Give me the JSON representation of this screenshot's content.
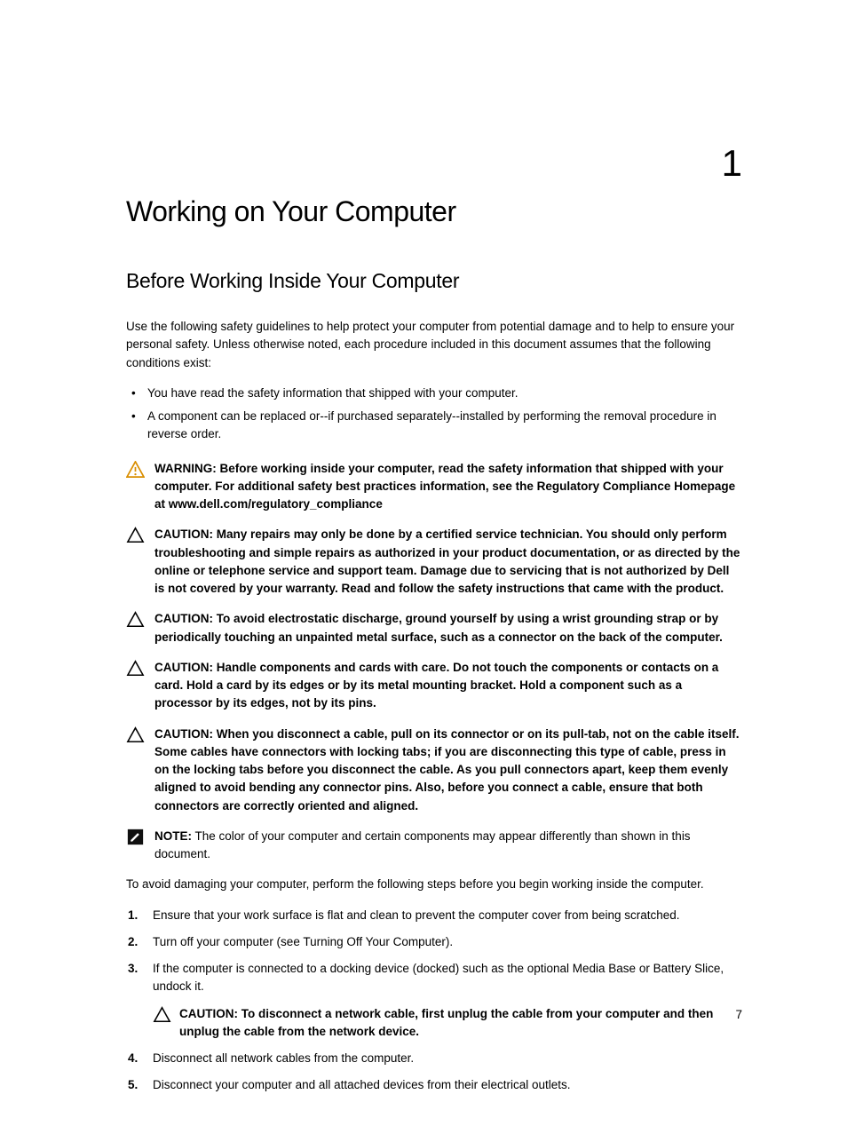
{
  "chapterNumber": "1",
  "title": "Working on Your Computer",
  "subheading": "Before Working Inside Your Computer",
  "intro": "Use the following safety guidelines to help protect your computer from potential damage and to help to ensure your personal safety. Unless otherwise noted, each procedure included in this document assumes that the following conditions exist:",
  "bullets": [
    "You have read the safety information that shipped with your computer.",
    "A component can be replaced or--if purchased separately--installed by performing the removal procedure in reverse order."
  ],
  "admonitions": [
    {
      "kind": "warning",
      "label": "WARNING:",
      "text": " Before working inside your computer, read the safety information that shipped with your computer. For additional safety best practices information, see the Regulatory Compliance Homepage at www.dell.com/regulatory_compliance"
    },
    {
      "kind": "caution",
      "label": "CAUTION:",
      "text": " Many repairs may only be done by a certified service technician. You should only perform troubleshooting and simple repairs as authorized in your product documentation, or as directed by the online or telephone service and support team. Damage due to servicing that is not authorized by Dell is not covered by your warranty. Read and follow the safety instructions that came with the product."
    },
    {
      "kind": "caution",
      "label": "CAUTION:",
      "text": " To avoid electrostatic discharge, ground yourself by using a wrist grounding strap or by periodically touching an unpainted metal surface, such as a connector on the back of the computer."
    },
    {
      "kind": "caution",
      "label": "CAUTION:",
      "text": " Handle components and cards with care. Do not touch the components or contacts on a card. Hold a card by its edges or by its metal mounting bracket. Hold a component such as a processor by its edges, not by its pins."
    },
    {
      "kind": "caution",
      "label": "CAUTION:",
      "text": " When you disconnect a cable, pull on its connector or on its pull-tab, not on the cable itself. Some cables have connectors with locking tabs; if you are disconnecting this type of cable, press in on the locking tabs before you disconnect the cable. As you pull connectors apart, keep them evenly aligned to avoid bending any connector pins. Also, before you connect a cable, ensure that both connectors are correctly oriented and aligned."
    },
    {
      "kind": "note",
      "label": "NOTE:",
      "text": " The color of your computer and certain components may appear differently than shown in this document."
    }
  ],
  "transition": "To avoid damaging your computer, perform the following steps before you begin working inside the computer.",
  "steps": [
    {
      "text": "Ensure that your work surface is flat and clean to prevent the computer cover from being scratched."
    },
    {
      "text": "Turn off your computer (see Turning Off Your Computer)."
    },
    {
      "text": "If the computer is connected to a docking device (docked) such as the optional Media Base or Battery Slice, undock it.",
      "admon": {
        "kind": "caution",
        "label": "CAUTION:",
        "text": " To disconnect a network cable, first unplug the cable from your computer and then unplug the cable from the network device."
      }
    },
    {
      "text": "Disconnect all network cables from the computer."
    },
    {
      "text": "Disconnect your computer and all attached devices from their electrical outlets."
    }
  ],
  "pageNumber": "7"
}
